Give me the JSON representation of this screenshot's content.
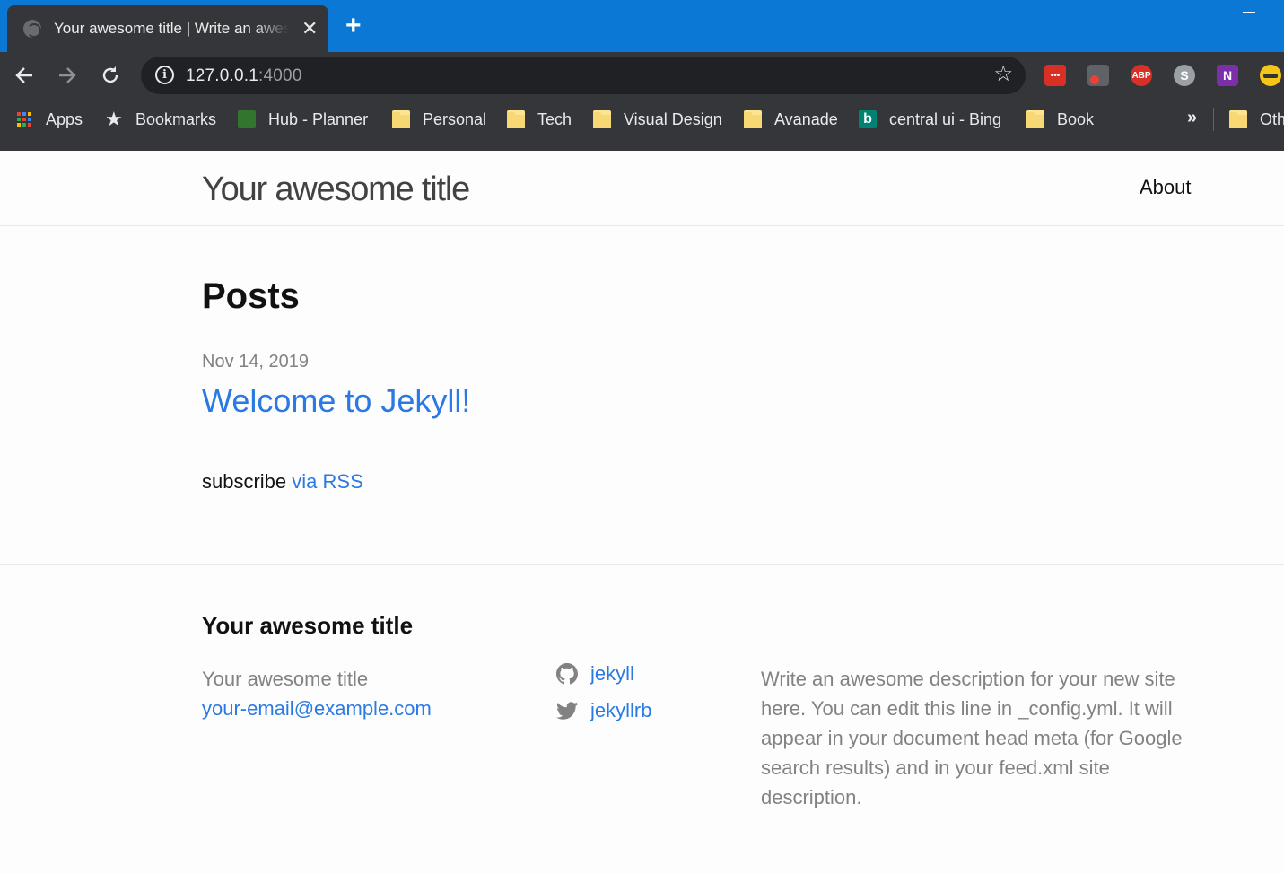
{
  "browser": {
    "tab_title": "Your awesome title | Write an awesome description for your new site",
    "new_tab": "+",
    "tab_close": "✕",
    "url_host": "127.0.0.1",
    "url_port": ":4000",
    "bookmarks": [
      {
        "label": "Apps",
        "icon": "apps-grid-icon"
      },
      {
        "label": "Bookmarks",
        "icon": "star-icon"
      },
      {
        "label": "Hub - Planner",
        "icon": "planner-icon"
      },
      {
        "label": "Personal",
        "icon": "folder-icon"
      },
      {
        "label": "Tech",
        "icon": "folder-icon"
      },
      {
        "label": "Visual Design",
        "icon": "folder-icon"
      },
      {
        "label": "Avanade",
        "icon": "folder-icon"
      },
      {
        "label": "central ui - Bing",
        "icon": "bing-icon"
      },
      {
        "label": "Book",
        "icon": "folder-icon"
      },
      {
        "label": "Oth",
        "icon": "folder-icon"
      }
    ],
    "overflow": "»",
    "extensions": {
      "abp": "ABP",
      "skype": "S",
      "onenote": "N"
    }
  },
  "site": {
    "title": "Your awesome title",
    "nav": [
      "About"
    ]
  },
  "main": {
    "heading": "Posts",
    "posts": [
      {
        "date": "Nov 14, 2019",
        "title": "Welcome to Jekyll!"
      }
    ],
    "subscribe_prefix": "subscribe",
    "subscribe_link": "via RSS"
  },
  "footer": {
    "heading": "Your awesome title",
    "name": "Your awesome title",
    "email": "your-email@example.com",
    "social": [
      {
        "icon": "github-icon",
        "label": "jekyll"
      },
      {
        "icon": "twitter-icon",
        "label": "jekyllrb"
      }
    ],
    "description": "Write an awesome description for your new site here. You can edit this line in _config.yml. It will appear in your document head meta (for Google search results) and in your feed.xml site description."
  }
}
